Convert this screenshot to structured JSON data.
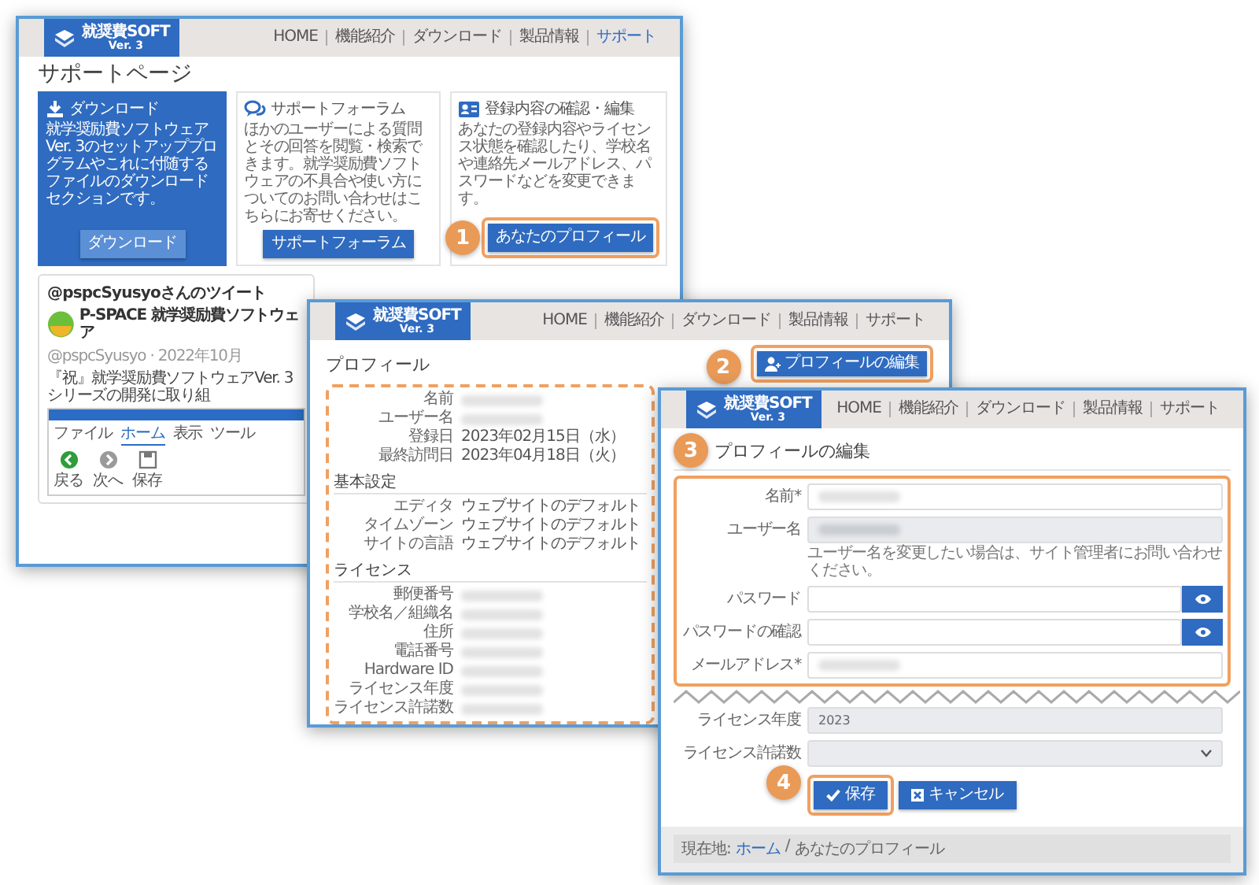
{
  "support_page": {
    "logo": {
      "name": "就奨費SOFT",
      "version": "Ver. 3"
    },
    "nav": [
      {
        "label": "HOME",
        "selected": false
      },
      {
        "label": "機能紹介",
        "selected": false
      },
      {
        "label": "ダウンロード",
        "selected": false
      },
      {
        "label": "製品情報",
        "selected": false
      },
      {
        "label": "サポート",
        "selected": true
      }
    ],
    "title": "サポートページ",
    "cards": [
      {
        "kind": "download",
        "heading": "ダウンロード",
        "text": "就学奨励費ソフトウェア Ver. 3のセットアッププログラムやこれに付随するファイルのダウンロードセクションです。",
        "button": "ダウンロード",
        "featured": true
      },
      {
        "kind": "forum",
        "heading": "サポートフォーラム",
        "text": "ほかのユーザーによる質問とその回答を閲覧・検索できます。就学奨励費ソフトウェアの不具合や使い方についてのお問い合わせはこちらにお寄せください。",
        "button": "サポートフォーラム",
        "featured": false
      },
      {
        "kind": "profile",
        "heading": "登録内容の確認・編集",
        "text": "あなたの登録内容やライセンス状態を確認したり、学校名や連絡先メールアドレス、パスワードなどを変更できます。",
        "button": "あなたのプロフィール",
        "featured": false,
        "step": "1"
      }
    ],
    "tweets": {
      "heading": "@pspcSyusyoさんのツイート",
      "author": "P-SPACE 就学奨励費ソフトウェア",
      "handle": "@pspcSyusyo · 2022年10月",
      "text": "『祝』就学奨励費ソフトウェアVer. 3シリーズの開発に取り組",
      "embed": {
        "tabs": [
          {
            "label": "ファイル",
            "selected": false
          },
          {
            "label": "ホーム",
            "selected": true
          },
          {
            "label": "表示",
            "selected": false
          },
          {
            "label": "ツール",
            "selected": false
          }
        ],
        "buttons": [
          {
            "kind": "back",
            "label": "戻る"
          },
          {
            "kind": "forward",
            "label": "次へ"
          },
          {
            "kind": "save",
            "label": "保存"
          }
        ]
      }
    }
  },
  "profile_page": {
    "logo": {
      "name": "就奨費SOFT",
      "version": "Ver. 3"
    },
    "nav": [
      {
        "label": "HOME",
        "selected": false
      },
      {
        "label": "機能紹介",
        "selected": false
      },
      {
        "label": "ダウンロード",
        "selected": false
      },
      {
        "label": "製品情報",
        "selected": false
      },
      {
        "label": "サポート",
        "selected": false
      }
    ],
    "title": "プロフィール",
    "edit_button": {
      "label": "プロフィールの編集",
      "step": "2"
    },
    "sections": [
      {
        "rows": [
          {
            "label": "名前",
            "redacted": true
          },
          {
            "label": "ユーザー名",
            "redacted": true
          },
          {
            "label": "登録日",
            "value": "2023年02月15日（水）"
          },
          {
            "label": "最終訪問日",
            "value": "2023年04月18日（火）"
          }
        ]
      },
      {
        "heading": "基本設定",
        "rows": [
          {
            "label": "エディタ",
            "value": "ウェブサイトのデフォルト"
          },
          {
            "label": "タイムゾーン",
            "value": "ウェブサイトのデフォルト"
          },
          {
            "label": "サイトの言語",
            "value": "ウェブサイトのデフォルト"
          }
        ]
      },
      {
        "heading": "ライセンス",
        "rows": [
          {
            "label": "郵便番号",
            "redacted": true
          },
          {
            "label": "学校名／組織名",
            "redacted": true
          },
          {
            "label": "住所",
            "redacted": true
          },
          {
            "label": "電話番号",
            "redacted": true
          },
          {
            "label": "Hardware ID",
            "redacted": true
          },
          {
            "label": "ライセンス年度",
            "redacted": true
          },
          {
            "label": "ライセンス許諾数",
            "redacted": true
          }
        ]
      }
    ]
  },
  "edit_page": {
    "logo": {
      "name": "就奨費SOFT",
      "version": "Ver. 3"
    },
    "nav": [
      {
        "label": "HOME",
        "selected": false
      },
      {
        "label": "機能紹介",
        "selected": false
      },
      {
        "label": "ダウンロード",
        "selected": false
      },
      {
        "label": "製品情報",
        "selected": false
      },
      {
        "label": "サポート",
        "selected": false
      }
    ],
    "title": "プロフィールの編集",
    "step": "3",
    "fields": [
      {
        "label": "名前*",
        "kind": "text",
        "redacted": true
      },
      {
        "label": "ユーザー名",
        "kind": "readonly",
        "redacted": true,
        "help": "ユーザー名を変更したい場合は、サイト管理者にお問い合わせください。"
      },
      {
        "label": "パスワード",
        "kind": "password"
      },
      {
        "label": "パスワードの確認",
        "kind": "password"
      },
      {
        "label": "メールアドレス*",
        "kind": "text",
        "redacted": true
      }
    ],
    "fields_after_break": [
      {
        "label": "ライセンス年度",
        "kind": "readonly",
        "value": "2023"
      },
      {
        "label": "ライセンス許諾数",
        "kind": "select"
      }
    ],
    "buttons": [
      {
        "kind": "save",
        "label": "保存",
        "step": "4"
      },
      {
        "kind": "cancel",
        "label": "キャンセル"
      }
    ],
    "breadcrumb": {
      "label": "現在地:",
      "separator": "/",
      "items": [
        {
          "label": "ホーム",
          "link": true
        },
        {
          "label": "あなたのプロフィール",
          "link": false
        }
      ]
    }
  }
}
